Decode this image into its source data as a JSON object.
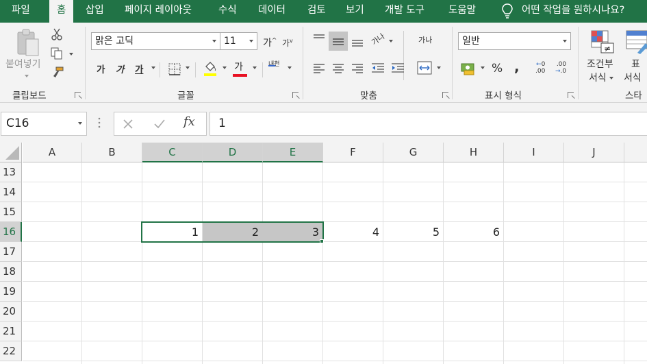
{
  "menu": {
    "tabs": [
      "파일",
      "홈",
      "삽입",
      "페이지 레이아웃",
      "수식",
      "데이터",
      "검토",
      "보기",
      "개발 도구",
      "도움말"
    ],
    "active_tab": "홈",
    "tell_me": "어떤 작업을 원하시나요?"
  },
  "ribbon": {
    "clipboard": {
      "paste_label": "붙여넣기",
      "group_label": "클립보드"
    },
    "font": {
      "font_name": "맑은 고딕",
      "font_size": "11",
      "grow_label": "가",
      "shrink_label": "가",
      "bold_label": "가",
      "italic_label": "가",
      "underline_label": "가",
      "font_color_label": "가",
      "phonetic_label": "내천",
      "group_label": "글꼴",
      "font_color": "#e81123"
    },
    "alignment": {
      "orientation_label": "가나",
      "wrap_label": "가나",
      "group_label": "맞춤"
    },
    "number": {
      "format": "일반",
      "percent_label": "%",
      "comma_label": ",",
      "inc_decimal": ".00",
      "dec_decimal": ".00",
      "group_label": "표시 형식"
    },
    "styles": {
      "conditional_line1": "조건부",
      "conditional_line2": "서식",
      "table_line1": "표",
      "table_line2": "서식",
      "group_label": "스타"
    }
  },
  "formula_bar": {
    "name_box": "C16",
    "fx_label": "fx",
    "value": "1"
  },
  "grid": {
    "columns": [
      "A",
      "B",
      "C",
      "D",
      "E",
      "F",
      "G",
      "H",
      "I",
      "J"
    ],
    "selected_columns": [
      "C",
      "D",
      "E"
    ],
    "rows": [
      "13",
      "14",
      "15",
      "16",
      "17",
      "18",
      "19",
      "20",
      "21",
      "22"
    ],
    "selected_row": "16",
    "cells": {
      "C16": "1",
      "D16": "2",
      "E16": "3",
      "F16": "4",
      "G16": "5",
      "H16": "6"
    }
  },
  "colors": {
    "accent": "#217346",
    "selection_fill": "#c6c6c6"
  }
}
